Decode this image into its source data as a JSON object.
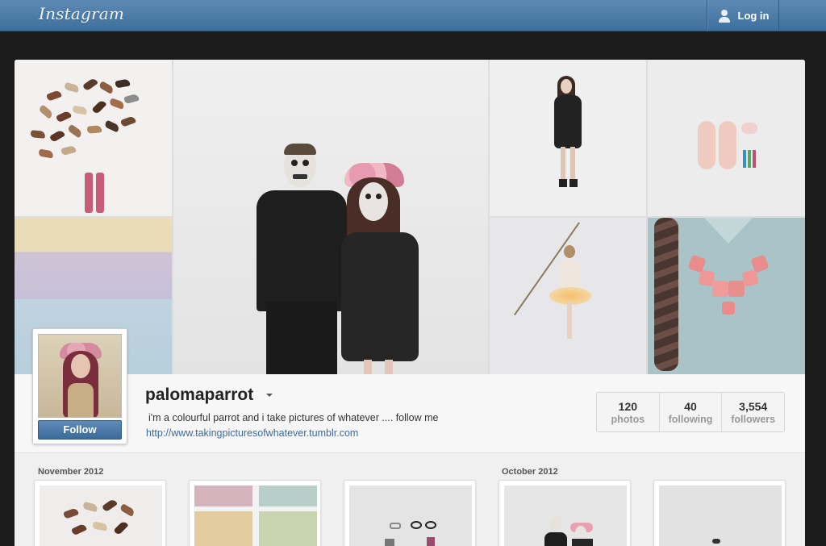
{
  "header": {
    "logo": "Instagram",
    "login_label": "Log in"
  },
  "profile": {
    "username": "paloma.parrot",
    "username_display": "palomaparrot",
    "bio": "i'm a colourful parrot and i take pictures of whatever .... follow me",
    "website": "http://www.takingpicturesofwhatever.tumblr.com",
    "follow_label": "Follow",
    "stats": [
      {
        "value": "120",
        "label": "photos"
      },
      {
        "value": "40",
        "label": "following"
      },
      {
        "value": "3,554",
        "label": "followers"
      }
    ]
  },
  "feed": {
    "months": [
      "November 2012",
      "October 2012"
    ]
  },
  "colors": {
    "topbar": "#4a78a6",
    "link": "#3d6a99",
    "follow_button": "#4d7bab"
  }
}
